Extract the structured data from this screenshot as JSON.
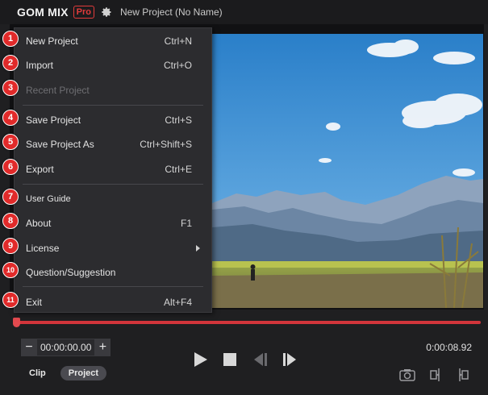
{
  "app": {
    "brand": "GOM MIX",
    "edition": "Pro",
    "project_title": "New Project (No Name)"
  },
  "menu": {
    "items": [
      {
        "label": "New Project",
        "shortcut": "Ctrl+N",
        "badge": "1",
        "enabled": true
      },
      {
        "label": "Import",
        "shortcut": "Ctrl+O",
        "badge": "2",
        "enabled": true
      },
      {
        "label": "Recent Project",
        "shortcut": "",
        "badge": "3",
        "enabled": false
      },
      {
        "label": "Save Project",
        "shortcut": "Ctrl+S",
        "badge": "4",
        "enabled": true
      },
      {
        "label": "Save Project As",
        "shortcut": "Ctrl+Shift+S",
        "badge": "5",
        "enabled": true
      },
      {
        "label": "Export",
        "shortcut": "Ctrl+E",
        "badge": "6",
        "enabled": true
      },
      {
        "label": "User Guide",
        "shortcut": "",
        "badge": "7",
        "enabled": true
      },
      {
        "label": "About",
        "shortcut": "F1",
        "badge": "8",
        "enabled": true
      },
      {
        "label": "License",
        "shortcut": "",
        "badge": "9",
        "enabled": true,
        "submenu": true
      },
      {
        "label": "Question/Suggestion",
        "shortcut": "",
        "badge": "10",
        "enabled": true
      },
      {
        "label": "Exit",
        "shortcut": "Alt+F4",
        "badge": "11",
        "enabled": true
      }
    ]
  },
  "controls": {
    "minus": "−",
    "plus": "+",
    "current_time": "00:00:00.00",
    "duration": "0:00:08.92",
    "modes": [
      "Clip",
      "Project"
    ],
    "active_mode": "Project"
  },
  "colors": {
    "accent": "#d2353b",
    "badge": "#e12a2a",
    "background": "#1f1f21",
    "menu": "#2c2c2f"
  },
  "icons": [
    "gear-icon",
    "play-icon",
    "stop-icon",
    "prev-frame-icon",
    "next-frame-icon",
    "camera-icon",
    "split-left-icon",
    "split-right-icon",
    "submenu-arrow-icon"
  ]
}
